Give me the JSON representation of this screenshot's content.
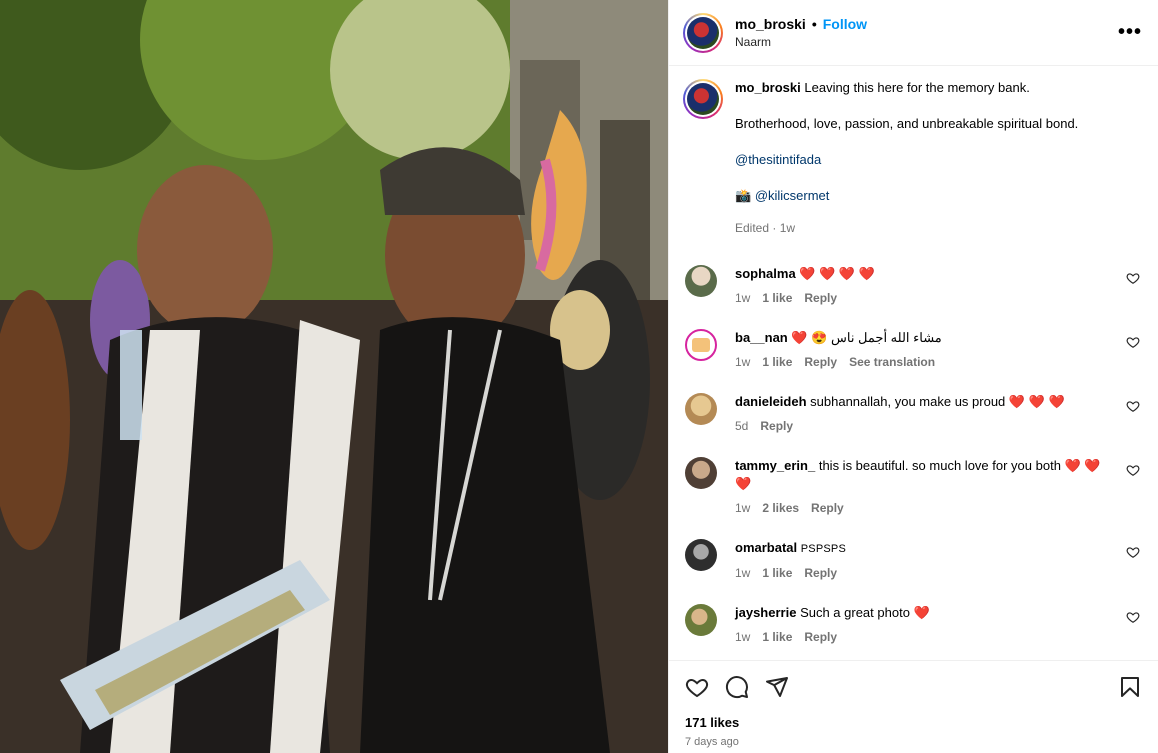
{
  "post": {
    "username": "mo_broski",
    "follow_label": "Follow",
    "location": "Naarm",
    "more_label": "•••"
  },
  "caption": {
    "username": "mo_broski",
    "line1": "Leaving this here for the memory bank.",
    "line2": "Brotherhood, love, passion, and unbreakable spiritual bond.",
    "mention1": "@thesitintifada",
    "camera_emoji": "📸",
    "mention2": "@kilicsermet",
    "meta": "Edited · 1w"
  },
  "comments": [
    {
      "user": "sophalma",
      "text": "❤️ ❤️ ❤️ ❤️",
      "time": "1w",
      "likes": "1 like",
      "reply": "Reply",
      "extra": ""
    },
    {
      "user": "ba__nan",
      "text": "❤️ 😍 مشاء الله أجمل ناس",
      "time": "1w",
      "likes": "1 like",
      "reply": "Reply",
      "extra": "See translation"
    },
    {
      "user": "danieleideh",
      "text": "subhannallah, you make us proud ❤️ ❤️ ❤️",
      "time": "5d",
      "likes": "",
      "reply": "Reply",
      "extra": ""
    },
    {
      "user": "tammy_erin_",
      "text": "this is beautiful. so much love for you both ❤️ ❤️ ❤️",
      "time": "1w",
      "likes": "2 likes",
      "reply": "Reply",
      "extra": ""
    },
    {
      "user": "omarbatal",
      "text": "PSPSPS",
      "time": "1w",
      "likes": "1 like",
      "reply": "Reply",
      "extra": ""
    },
    {
      "user": "jaysherrie",
      "text": "Such a great photo ❤️",
      "time": "1w",
      "likes": "1 like",
      "reply": "Reply",
      "extra": ""
    }
  ],
  "footer": {
    "likes": "171 likes",
    "ago": "7 days ago"
  },
  "icons": {
    "like": "heart-icon",
    "comment": "comment-icon",
    "share": "share-icon",
    "save": "bookmark-icon"
  },
  "colors": {
    "follow": "#0095f6",
    "mention": "#00376b",
    "meta": "#737373"
  }
}
